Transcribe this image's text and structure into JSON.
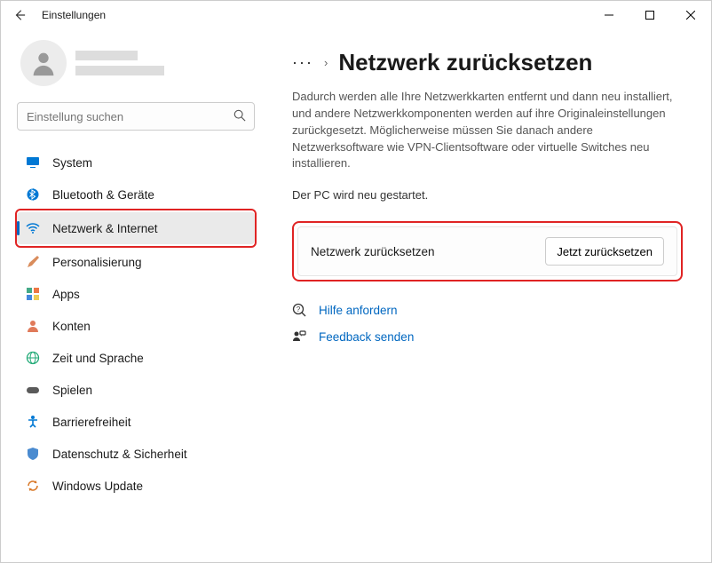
{
  "titlebar": {
    "title": "Einstellungen"
  },
  "search": {
    "placeholder": "Einstellung suchen"
  },
  "sidebar": {
    "items": [
      {
        "label": "System"
      },
      {
        "label": "Bluetooth & Geräte"
      },
      {
        "label": "Netzwerk & Internet"
      },
      {
        "label": "Personalisierung"
      },
      {
        "label": "Apps"
      },
      {
        "label": "Konten"
      },
      {
        "label": "Zeit und Sprache"
      },
      {
        "label": "Spielen"
      },
      {
        "label": "Barrierefreiheit"
      },
      {
        "label": "Datenschutz & Sicherheit"
      },
      {
        "label": "Windows Update"
      }
    ]
  },
  "main": {
    "ellipsis": "···",
    "page_title": "Netzwerk zurücksetzen",
    "description": "Dadurch werden alle Ihre Netzwerkkarten entfernt und dann neu installiert, und andere Netzwerkkomponenten werden auf ihre Originaleinstellungen zurückgesetzt. Möglicherweise müssen Sie danach andere Netzwerksoftware wie VPN-Clientsoftware oder virtuelle Switches neu installieren.",
    "restart_note": "Der PC wird neu gestartet.",
    "card": {
      "label": "Netzwerk zurücksetzen",
      "button": "Jetzt zurücksetzen"
    },
    "help_link": "Hilfe anfordern",
    "feedback_link": "Feedback senden"
  }
}
